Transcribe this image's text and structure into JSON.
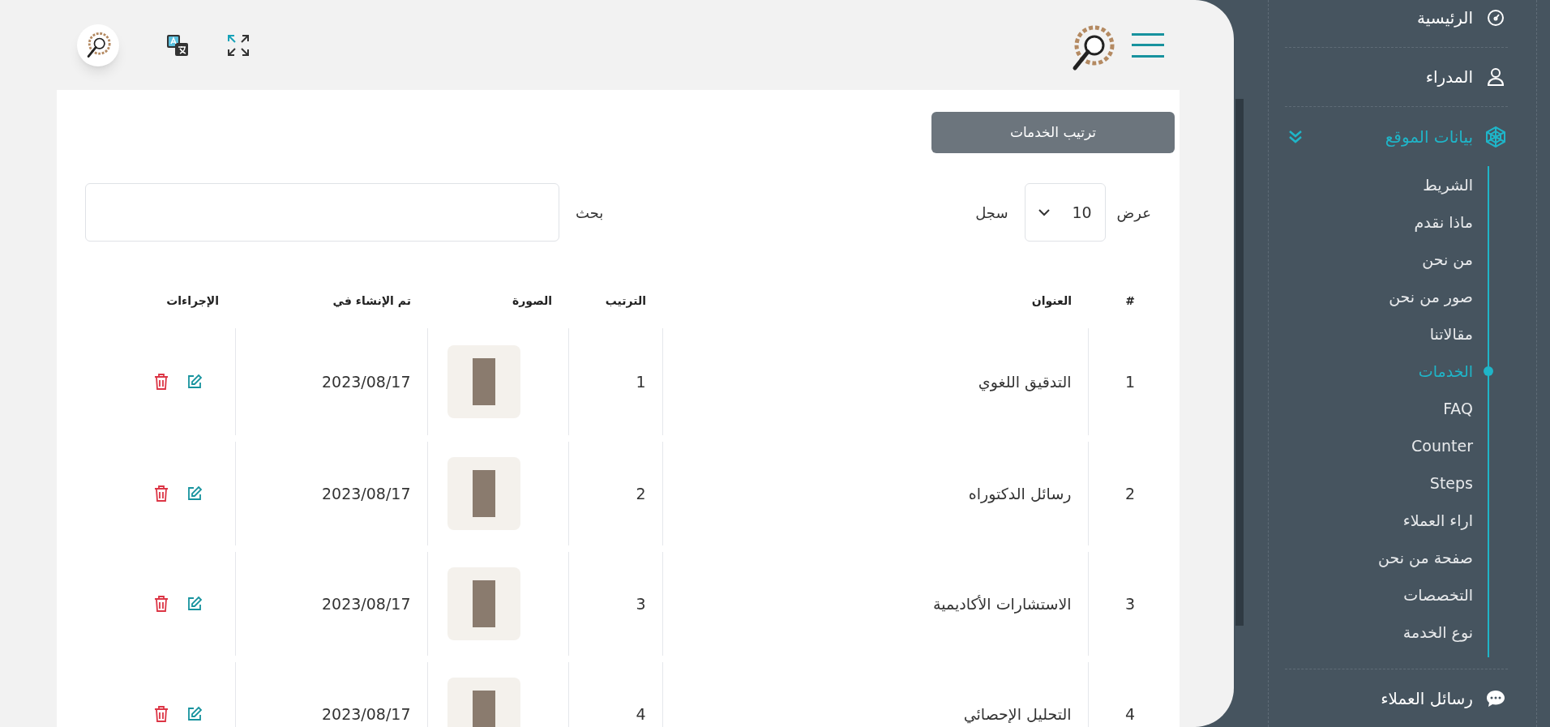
{
  "toolbar": {
    "sort_button": "ترتيب الخدمات",
    "show_label": "عرض",
    "page_size": "10",
    "records_label": "سجل",
    "search_label": "بحث"
  },
  "table": {
    "columns": [
      "#",
      "العنوان",
      "الترتيب",
      "الصورة",
      "تم الإنشاء في",
      "الإجراءات"
    ],
    "rows": [
      {
        "number": "1",
        "title": "التدقيق اللغوي",
        "order": "1",
        "created": "2023/08/17"
      },
      {
        "number": "2",
        "title": "رسائل الدكتوراه",
        "order": "2",
        "created": "2023/08/17"
      },
      {
        "number": "3",
        "title": "الاستشارات الأكاديمية",
        "order": "3",
        "created": "2023/08/17"
      },
      {
        "number": "4",
        "title": "التحليل الإحصائي",
        "order": "4",
        "created": "2023/08/17"
      }
    ]
  },
  "sidebar": {
    "items": [
      {
        "label": "الرئيسية",
        "kind": "link",
        "active": false
      },
      {
        "label": "المدراء",
        "kind": "link",
        "active": false
      },
      {
        "label": "بيانات الموقع",
        "kind": "group",
        "active": true,
        "expanded": true,
        "children": [
          {
            "label": "الشريط",
            "selected": false
          },
          {
            "label": "ماذا نقدم",
            "selected": false
          },
          {
            "label": "من نحن",
            "selected": false
          },
          {
            "label": "صور من نحن",
            "selected": false
          },
          {
            "label": "مقالاتنا",
            "selected": false
          },
          {
            "label": "الخدمات",
            "selected": true
          },
          {
            "label": "FAQ",
            "selected": false
          },
          {
            "label": "Counter",
            "selected": false
          },
          {
            "label": "Steps",
            "selected": false
          },
          {
            "label": "اراء العملاء",
            "selected": false
          },
          {
            "label": "صفحة من نحن",
            "selected": false
          },
          {
            "label": "التخصصات",
            "selected": false
          },
          {
            "label": "نوع الخدمة",
            "selected": false
          }
        ]
      },
      {
        "label": "رسائل العملاء",
        "kind": "link",
        "active": false
      }
    ]
  }
}
